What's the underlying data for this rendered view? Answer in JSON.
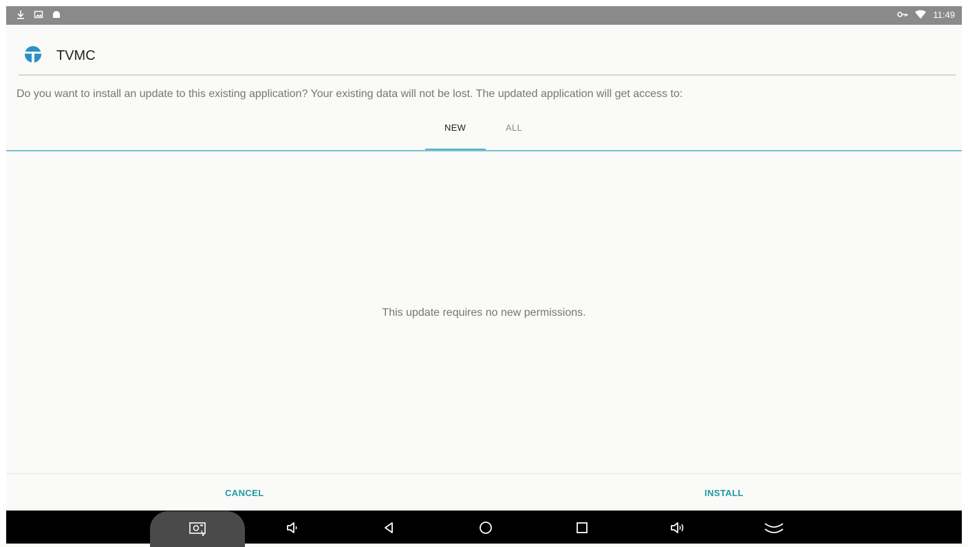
{
  "status_bar": {
    "time": "11:49",
    "left_icons": [
      "download-icon",
      "image-notification-icon",
      "android-icon"
    ],
    "right_icons": [
      "vpn-key-icon",
      "wifi-icon"
    ]
  },
  "app": {
    "name": "TVMC",
    "logo_color": "#2a93c5"
  },
  "dialog": {
    "prompt": "Do you want to install an update to this existing application? Your existing data will not be lost. The updated application will get access to:",
    "tabs": [
      {
        "label": "NEW",
        "selected": true
      },
      {
        "label": "ALL",
        "selected": false
      }
    ],
    "message": "This update requires no new permissions.",
    "cancel_label": "CANCEL",
    "install_label": "INSTALL"
  },
  "colors": {
    "accent": "#1f9aa2",
    "tab_indicator": "#56b2c7",
    "status_bar": "#8a8a8a"
  },
  "nav_bar": {
    "icons": [
      "screenshot-icon",
      "volume-down-icon",
      "back-icon",
      "home-icon",
      "recents-icon",
      "volume-up-icon",
      "collapse-icon"
    ]
  }
}
